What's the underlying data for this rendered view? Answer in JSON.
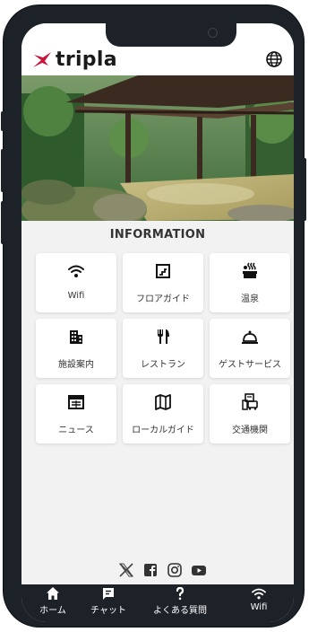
{
  "header": {
    "brand": "tripla",
    "brand_color": "#c8163a",
    "language_icon": "globe-icon"
  },
  "hero": {
    "icon": "hot-spring-photo"
  },
  "section_title": "INFORMATION",
  "tiles": [
    {
      "label": "Wifi",
      "icon": "wifi-icon"
    },
    {
      "label": "フロアガイド",
      "icon": "floor-guide-icon"
    },
    {
      "label": "温泉",
      "icon": "hot-spring-icon"
    },
    {
      "label": "施設案内",
      "icon": "building-icon"
    },
    {
      "label": "レストラン",
      "icon": "fork-knife-icon"
    },
    {
      "label": "ゲストサービス",
      "icon": "service-bell-icon"
    },
    {
      "label": "ニュース",
      "icon": "news-icon"
    },
    {
      "label": "ローカルガイド",
      "icon": "map-icon"
    },
    {
      "label": "交通機関",
      "icon": "transport-icon"
    }
  ],
  "social": [
    "x-icon",
    "facebook-icon",
    "instagram-icon",
    "youtube-icon"
  ],
  "bottom_nav": [
    {
      "label": "ホーム",
      "icon": "home-icon"
    },
    {
      "label": "チャット",
      "icon": "chat-icon"
    },
    {
      "label": "よくある質問",
      "icon": "question-icon"
    },
    {
      "label": "Wifi",
      "icon": "wifi-icon"
    }
  ]
}
